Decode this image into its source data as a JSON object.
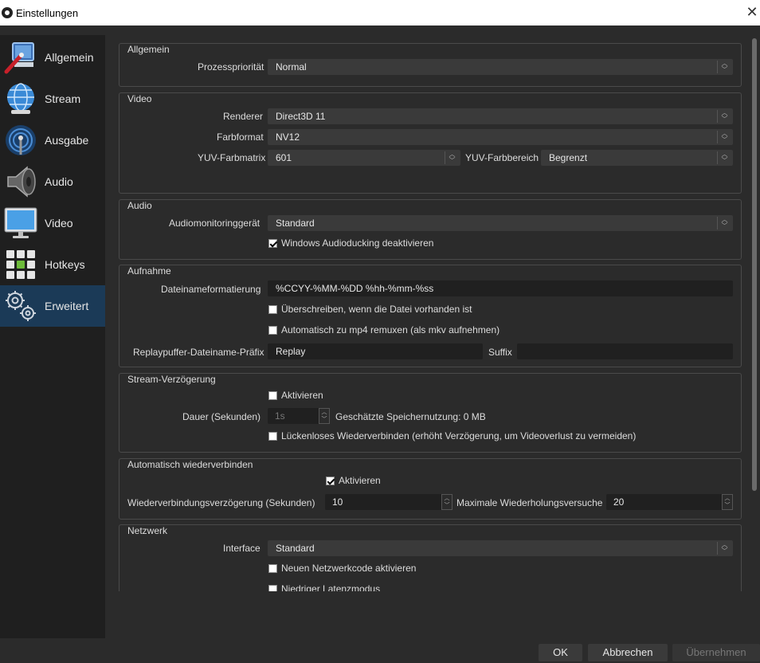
{
  "window": {
    "title": "Einstellungen"
  },
  "sidebar": {
    "items": [
      {
        "label": "Allgemein",
        "icon": "general-settings-icon"
      },
      {
        "label": "Stream",
        "icon": "globe-stream-icon"
      },
      {
        "label": "Ausgabe",
        "icon": "broadcast-output-icon"
      },
      {
        "label": "Audio",
        "icon": "speaker-icon"
      },
      {
        "label": "Video",
        "icon": "monitor-icon"
      },
      {
        "label": "Hotkeys",
        "icon": "keyboard-icon"
      },
      {
        "label": "Erweitert",
        "icon": "gears-icon",
        "active": true
      }
    ]
  },
  "general": {
    "title": "Allgemein",
    "priority_label": "Prozesspriorität",
    "priority_value": "Normal"
  },
  "video": {
    "title": "Video",
    "renderer_label": "Renderer",
    "renderer_value": "Direct3D 11",
    "format_label": "Farbformat",
    "format_value": "NV12",
    "matrix_label": "YUV-Farbmatrix",
    "matrix_value": "601",
    "range_label": "YUV-Farbbereich",
    "range_value": "Begrenzt"
  },
  "audio": {
    "title": "Audio",
    "monitor_label": "Audiomonitoringgerät",
    "monitor_value": "Standard",
    "ducking_label": "Windows Audioducking deaktivieren",
    "ducking_checked": true
  },
  "recording": {
    "title": "Aufnahme",
    "filename_label": "Dateinameformatierung",
    "filename_value": "%CCYY-%MM-%DD %hh-%mm-%ss",
    "overwrite_label": "Überschreiben, wenn die Datei vorhanden ist",
    "remux_label": "Automatisch zu mp4 remuxen (als mkv aufnehmen)",
    "replay_prefix_label": "Replaypuffer-Dateiname-Präfix",
    "replay_prefix_value": "Replay",
    "suffix_label": "Suffix",
    "suffix_value": ""
  },
  "stream_delay": {
    "title": "Stream-Verzögerung",
    "enable_label": "Aktivieren",
    "duration_label": "Dauer (Sekunden)",
    "duration_value": "1s",
    "memory_label": "Geschätzte Speichernutzung: 0 MB",
    "preserve_label": "Lückenloses Wiederverbinden (erhöht Verzögerung, um Videoverlust zu vermeiden)"
  },
  "reconnect": {
    "title": "Automatisch wiederverbinden",
    "enable_label": "Aktivieren",
    "enable_checked": true,
    "delay_label": "Wiederverbindungsverzögerung (Sekunden)",
    "delay_value": "10",
    "retries_label": "Maximale Wiederholungsversuche",
    "retries_value": "20"
  },
  "network": {
    "title": "Netzwerk",
    "interface_label": "Interface",
    "interface_value": "Standard",
    "new_code_label": "Neuen Netzwerkcode aktivieren",
    "low_latency_label": "Niedriger Latenzmodus"
  },
  "buttons": {
    "ok": "OK",
    "cancel": "Abbrechen",
    "apply": "Übernehmen"
  }
}
